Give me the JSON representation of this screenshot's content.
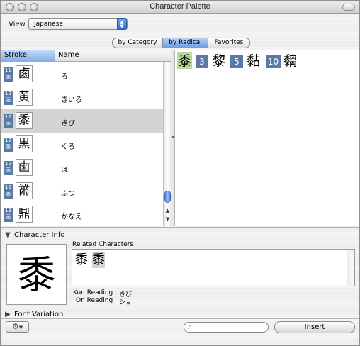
{
  "window": {
    "title": "Character Palette"
  },
  "view": {
    "label": "View :",
    "selected": "Japanese"
  },
  "tabs": [
    {
      "label": "by Category",
      "selected": false
    },
    {
      "label": "by Radical",
      "selected": true
    },
    {
      "label": "Favorites",
      "selected": false
    }
  ],
  "list": {
    "columns": {
      "stroke": "Stroke",
      "name": "Name"
    },
    "rows": [
      {
        "stroke_top": "11",
        "stroke_bottom": "画",
        "char": "鹵",
        "name": "ろ"
      },
      {
        "stroke_top": "12",
        "stroke_bottom": "画",
        "char": "黄",
        "name": "きいろ"
      },
      {
        "stroke_top": "12",
        "stroke_bottom": "画",
        "char": "黍",
        "name": "きび"
      },
      {
        "stroke_top": "12",
        "stroke_bottom": "画",
        "char": "黒",
        "name": "くろ"
      },
      {
        "stroke_top": "12",
        "stroke_bottom": "画",
        "char": "歯",
        "name": "は"
      },
      {
        "stroke_top": "12",
        "stroke_bottom": "画",
        "char": "黹",
        "name": "ふつ"
      },
      {
        "stroke_top": "13",
        "stroke_bottom": "画",
        "char": "鼎",
        "name": "かなえ"
      }
    ],
    "selected_index": 2
  },
  "right_pane": {
    "items": [
      {
        "type": "char",
        "value": "黍"
      },
      {
        "type": "num",
        "value": "3"
      },
      {
        "type": "char",
        "value": "黎"
      },
      {
        "type": "num",
        "value": "5"
      },
      {
        "type": "char",
        "value": "黏"
      },
      {
        "type": "num",
        "value": "10"
      },
      {
        "type": "char",
        "value": "黐"
      }
    ]
  },
  "character_info": {
    "label": "Character Info",
    "big_char": "黍",
    "related_label": "Related Characters",
    "related": [
      "黍",
      "黍"
    ],
    "kun_reading_label": "Kun Reading :",
    "kun_reading": "きび",
    "on_reading_label": "On Reading :",
    "on_reading": "ショ"
  },
  "font_variation": {
    "label": "Font Variation"
  },
  "bottom": {
    "search_value": "",
    "insert_label": "Insert"
  },
  "colors": {
    "selection_blue": "#6c9de6",
    "stroke_badge": "#5a7aa8",
    "highlight_green": "#b9dc9e"
  }
}
